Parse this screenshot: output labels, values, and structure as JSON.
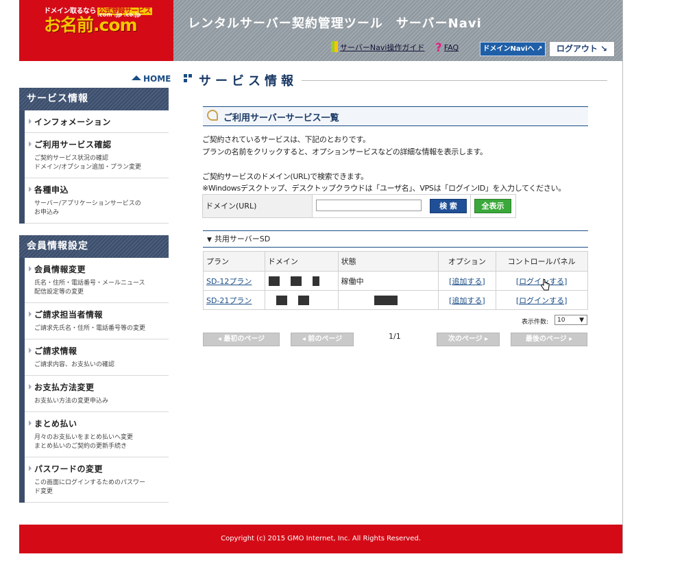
{
  "header": {
    "logo_tagline": "ドメイン取るなら",
    "logo_badge": "公式登録サービス",
    "logo_name": "お名前.com",
    "logo_tlds": ".com .jp .co.jp",
    "title": "レンタルサーバー契約管理ツール　サーバーNavi",
    "guide_link": "サーバーNavi操作ガイド",
    "faq_link": "FAQ",
    "domain_navi_button": "ドメインNaviへ ↗",
    "logout_button": "ログアウト ↘"
  },
  "sidebar": {
    "home": "HOME",
    "service_section": {
      "title": "サービス情報",
      "items": [
        {
          "label": "インフォメーション",
          "sub": ""
        },
        {
          "label": "ご利用サービス確認",
          "sub": "ご契約サービス状況の確認\nドメイン/オプション追加・プラン変更"
        },
        {
          "label": "各種申込",
          "sub": "サーバー/アプリケーションサービスの\nお申込み"
        }
      ]
    },
    "member_section": {
      "title": "会員情報設定",
      "items": [
        {
          "label": "会員情報変更",
          "sub": "氏名・住所・電話番号・メールニュース\n配信設定等の変更"
        },
        {
          "label": "ご請求担当者情報",
          "sub": "ご請求先氏名・住所・電話番号等の変更"
        },
        {
          "label": "ご請求情報",
          "sub": "ご請求内容、お支払いの確認"
        },
        {
          "label": "お支払方法変更",
          "sub": "お支払い方法の変更申込み"
        },
        {
          "label": "まとめ払い",
          "sub": "月々のお支払いをまとめ払いへ変更\nまとめ払いのご契約の更新手続き"
        },
        {
          "label": "パスワードの変更",
          "sub": "この画面にログインするためのパスワー\nド変更"
        }
      ]
    }
  },
  "main": {
    "title": "サービス情報",
    "section_title": "ご利用サーバーサービス一覧",
    "desc1": "ご契約されているサービスは、下記のとおりです。",
    "desc2": "プランの名前をクリックすると、オプションサービスなどの詳細な情報を表示します。",
    "desc3": "ご契約サービスのドメイン(URL)で検索できます。",
    "desc4": "※Windowsデスクトップ、デスクトップクラウドは「ユーザ名」、VPSは「ログインID」を入力してください。",
    "search_label": "ドメイン(URL)",
    "search_value": "",
    "search_button": "検 索",
    "show_all_button": "全表示",
    "group_title": "共用サーバーSD",
    "table": {
      "headers": [
        "プラン",
        "ドメイン",
        "状態",
        "オプション",
        "コントロールパネル"
      ],
      "rows": [
        {
          "plan": "SD-12プラン",
          "status": "稼働中",
          "option": "[追加する]",
          "panel": "[ログインする]"
        },
        {
          "plan": "SD-21プラン",
          "status": "",
          "option": "[追加する]",
          "panel": "[ログインする]"
        }
      ]
    },
    "count_label": "表示件数:",
    "count_value": "10",
    "pager": {
      "first": "◂ 最初のページ",
      "prev": "◂ 前のページ",
      "page": "1/1",
      "next": "次のページ ▸",
      "last": "最後のページ ▸"
    }
  },
  "footer": {
    "copyright": "Copyright (c) 2015 GMO Internet, Inc. All Rights Reserved."
  },
  "colors": {
    "brand_red": "#d40b17",
    "navy": "#1a4c86",
    "search_blue": "#1f4f96",
    "show_all_green": "#3aa83a"
  }
}
